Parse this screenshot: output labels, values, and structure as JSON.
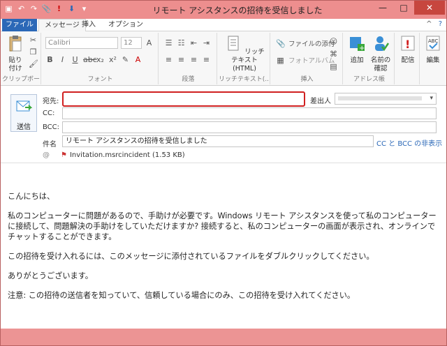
{
  "window": {
    "title": "リモート アシスタンスの招待を受信しました",
    "close": "✕",
    "minimize": "—",
    "maximize": "□"
  },
  "qat": {
    "save": "▣",
    "undo": "↶",
    "redo": "↷",
    "attach": "📎",
    "priority": "!",
    "down": "⬇",
    "more": "▾"
  },
  "tabs": {
    "file": "ファイル",
    "message": "メッセージ",
    "insert": "挿入",
    "options": "オプション",
    "help": "?",
    "collapse": "^"
  },
  "ribbon": {
    "paste": "貼り付け",
    "clipboard_label": "クリップボード",
    "font_name": "Calibri",
    "font_size": "12",
    "font_label": "フォント",
    "paragraph_label": "段落",
    "richtext": "リッチテキスト (HTML)",
    "richtext_label": "リッチテキスト(...",
    "attach_file": "ファイルの添付",
    "photo_album": "フォトアルバム",
    "insert_label": "挿入",
    "add": "追加",
    "check_names": "名前の確認",
    "address_label": "アドレス帳",
    "delivery": "配信",
    "edit": "編集"
  },
  "compose": {
    "send": "送信",
    "to_label": "宛先:",
    "to_value": "",
    "from_label": "差出人",
    "cc_label": "CC:",
    "bcc_label": "BCC:",
    "subject_label": "件名",
    "subject_value": "リモート アシスタンスの招待を受信しました",
    "hide_cc_bcc": "CC と BCC の非表示",
    "attachment_name": "Invitation.msrcincident (1.53 KB)"
  },
  "body": {
    "greeting": "こんにちは、",
    "p1": "私のコンピューターに問題があるので、手助けが必要です。Windows リモート アシスタンスを使って私のコンピューターに接続して、問題解決の手助けをしていただけますか? 接続すると、私のコンピューターの画面が表示され、オンラインでチャットすることができます。",
    "p2": "この招待を受け入れるには、このメッセージに添付されているファイルをダブルクリックしてください。",
    "p3": "ありがとうございます。",
    "p4": "注意: この招待の送信者を知っていて、信頼している場合にのみ、この招待を受け入れてください。"
  }
}
